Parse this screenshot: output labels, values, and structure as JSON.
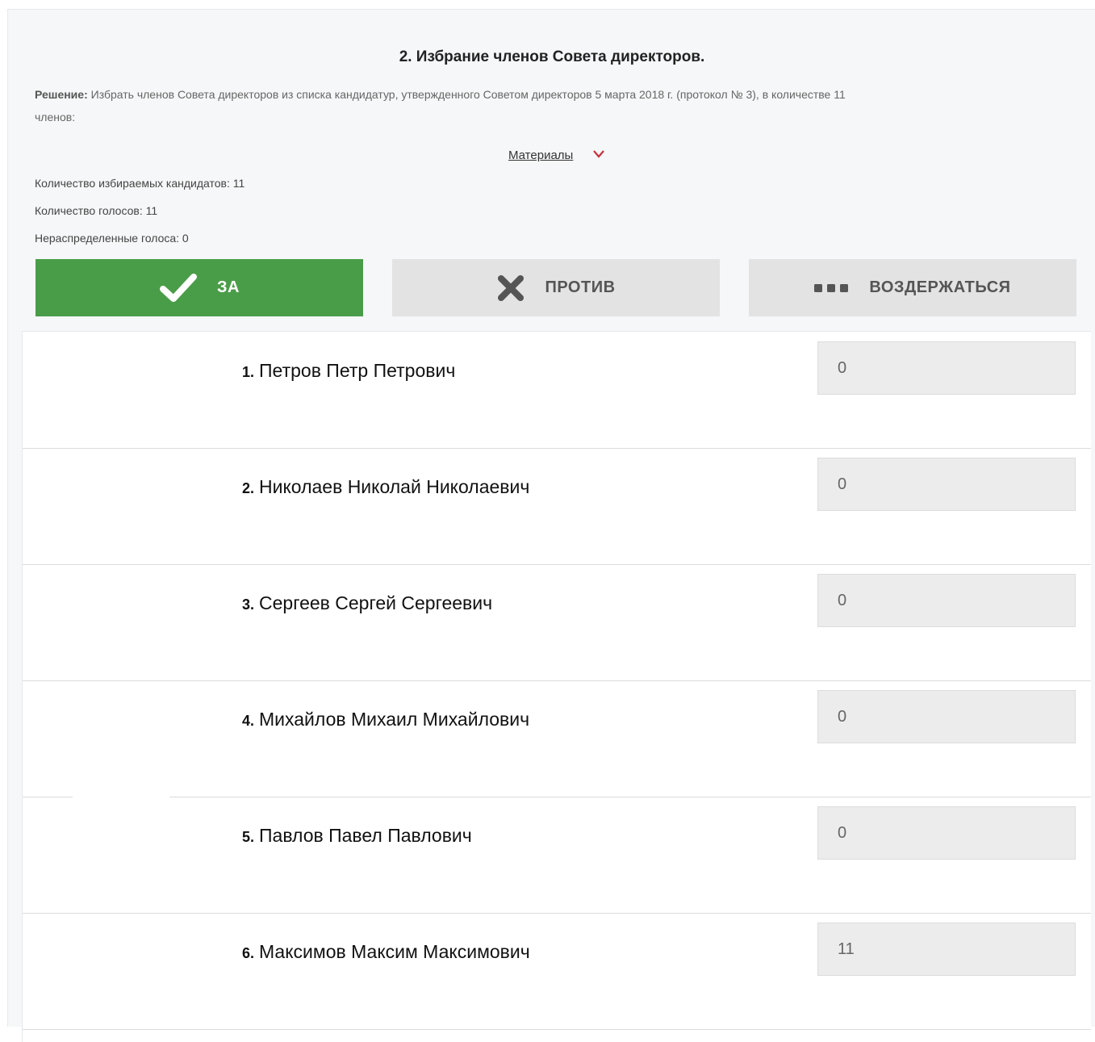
{
  "question": {
    "title": "2. Избрание членов Совета директоров.",
    "decision_label": "Решение:",
    "decision_text": "Избрать членов Совета директоров из списка кандидатур, утвержденного Советом директоров 5 марта 2018 г. (протокол № 3), в количестве 11 членов:",
    "materials_link": "Материалы"
  },
  "stats": {
    "candidates_count": "Количество избираемых кандидатов: 11",
    "votes_count": "Количество голосов: 11",
    "unallocated_votes": "Нераспределенные голоса: 0"
  },
  "vote_buttons": {
    "for": "ЗА",
    "against": "ПРОТИВ",
    "abstain": "ВОЗДЕРЖАТЬСЯ",
    "selected": "for"
  },
  "candidates": [
    {
      "num": "1.",
      "name": "Петров Петр Петрович",
      "votes": "0"
    },
    {
      "num": "2.",
      "name": "Николаев Николай Николаевич",
      "votes": "0"
    },
    {
      "num": "3.",
      "name": "Сергеев Сергей Сергеевич",
      "votes": "0"
    },
    {
      "num": "4.",
      "name": "Михайлов Михаил Михайлович",
      "votes": "0"
    },
    {
      "num": "5.",
      "name": "Павлов Павел Павлович",
      "votes": "0"
    },
    {
      "num": "6.",
      "name": "Максимов Максим Максимович",
      "votes": "11"
    }
  ],
  "colors": {
    "for_active": "#4a9d48",
    "button_inactive": "#e3e3e3",
    "chevron": "#c8323c"
  }
}
